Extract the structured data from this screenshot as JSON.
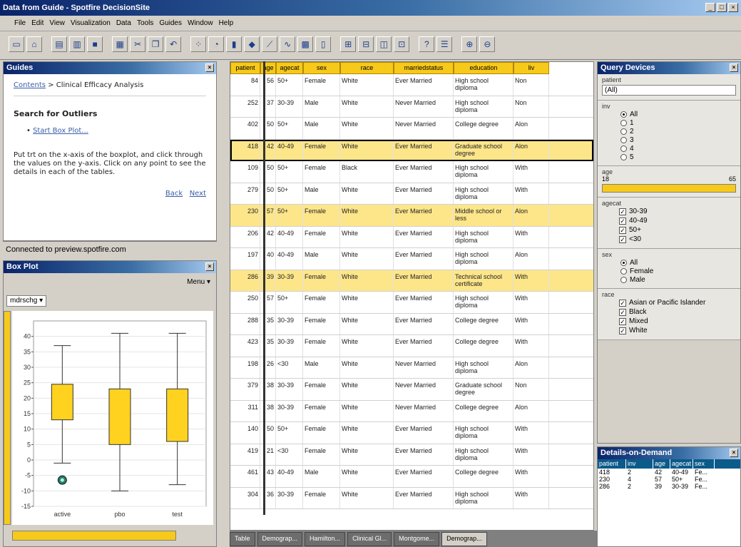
{
  "window": {
    "title": "Data from Guide - Spotfire DecisionSite"
  },
  "menu": [
    "File",
    "Edit",
    "View",
    "Visualization",
    "Data",
    "Tools",
    "Guides",
    "Window",
    "Help"
  ],
  "guides": {
    "title": "Guides",
    "breadcrumb_link": "Contents",
    "breadcrumb_rest": " > Clinical Efficacy Analysis",
    "heading": "Search for Outliers",
    "bullet_link": "Start Box Plot...",
    "body": "Put trt on the x-axis of the boxplot, and click through the values on the y-axis. Click on any point to see the details in each of the tables.",
    "back": "Back",
    "next": "Next"
  },
  "status": {
    "text": "Connected to preview.spotfire.com"
  },
  "boxplot": {
    "title": "Box Plot",
    "menu_label": "Menu",
    "y_selector": "mdrschg"
  },
  "chart_data": {
    "type": "box",
    "categories": [
      "active",
      "pbo",
      "test"
    ],
    "boxes": [
      {
        "category": "active",
        "min": -1,
        "q1": 13,
        "q3": 24.5,
        "max": 37
      },
      {
        "category": "pbo",
        "min": -10,
        "q1": 5,
        "q3": 23,
        "max": 41
      },
      {
        "category": "test",
        "min": -8,
        "q1": 6,
        "q3": 23,
        "max": 41
      }
    ],
    "outliers": [
      {
        "category": "active",
        "value": -6.5
      }
    ],
    "ylim": [
      -15,
      45
    ],
    "yticks": [
      -15,
      -10,
      -5,
      0,
      5,
      10,
      15,
      20,
      25,
      30,
      35,
      40
    ],
    "grid": true
  },
  "table": {
    "columns": [
      "patient",
      "age",
      "agecat",
      "sex",
      "race",
      "marriedstatus",
      "education",
      "liv"
    ],
    "rows": [
      {
        "patient": "84",
        "age": "56",
        "agecat": "50+",
        "sex": "Female",
        "race": "White",
        "married": "Ever Married",
        "education": "High school diploma",
        "liv": "Non"
      },
      {
        "patient": "252",
        "age": "37",
        "agecat": "30-39",
        "sex": "Male",
        "race": "White",
        "married": "Never Married",
        "education": "High school diploma",
        "liv": "Non"
      },
      {
        "patient": "402",
        "age": "50",
        "agecat": "50+",
        "sex": "Male",
        "race": "White",
        "married": "Never Married",
        "education": "College degree",
        "liv": "Alon"
      },
      {
        "patient": "418",
        "age": "42",
        "agecat": "40-49",
        "sex": "Female",
        "race": "White",
        "married": "Ever Married",
        "education": "Graduate school degree",
        "liv": "Alon"
      },
      {
        "patient": "109",
        "age": "50",
        "agecat": "50+",
        "sex": "Female",
        "race": "Black",
        "married": "Ever Married",
        "education": "High school diploma",
        "liv": "With"
      },
      {
        "patient": "279",
        "age": "50",
        "agecat": "50+",
        "sex": "Male",
        "race": "White",
        "married": "Ever Married",
        "education": "High school diploma",
        "liv": "With"
      },
      {
        "patient": "230",
        "age": "57",
        "agecat": "50+",
        "sex": "Female",
        "race": "White",
        "married": "Ever Married",
        "education": "Middle school or less",
        "liv": "Alon"
      },
      {
        "patient": "206",
        "age": "42",
        "agecat": "40-49",
        "sex": "Female",
        "race": "White",
        "married": "Ever Married",
        "education": "High school diploma",
        "liv": "With"
      },
      {
        "patient": "197",
        "age": "40",
        "agecat": "40-49",
        "sex": "Male",
        "race": "White",
        "married": "Ever Married",
        "education": "High school diploma",
        "liv": "Alon"
      },
      {
        "patient": "286",
        "age": "39",
        "agecat": "30-39",
        "sex": "Female",
        "race": "White",
        "married": "Ever Married",
        "education": "Technical school certificate",
        "liv": "With"
      },
      {
        "patient": "250",
        "age": "57",
        "agecat": "50+",
        "sex": "Female",
        "race": "White",
        "married": "Ever Married",
        "education": "High school diploma",
        "liv": "With"
      },
      {
        "patient": "288",
        "age": "35",
        "agecat": "30-39",
        "sex": "Female",
        "race": "White",
        "married": "Ever Married",
        "education": "College degree",
        "liv": "With"
      },
      {
        "patient": "423",
        "age": "35",
        "agecat": "30-39",
        "sex": "Female",
        "race": "White",
        "married": "Ever Married",
        "education": "College degree",
        "liv": "With"
      },
      {
        "patient": "198",
        "age": "26",
        "agecat": "<30",
        "sex": "Male",
        "race": "White",
        "married": "Never Married",
        "education": "High school diploma",
        "liv": "Alon"
      },
      {
        "patient": "379",
        "age": "38",
        "agecat": "30-39",
        "sex": "Female",
        "race": "White",
        "married": "Never Married",
        "education": "Graduate school degree",
        "liv": "Non"
      },
      {
        "patient": "311",
        "age": "38",
        "agecat": "30-39",
        "sex": "Female",
        "race": "White",
        "married": "Never Married",
        "education": "College degree",
        "liv": "Alon"
      },
      {
        "patient": "140",
        "age": "50",
        "agecat": "50+",
        "sex": "Female",
        "race": "White",
        "married": "Ever Married",
        "education": "High school diploma",
        "liv": "With"
      },
      {
        "patient": "419",
        "age": "21",
        "agecat": "<30",
        "sex": "Female",
        "race": "White",
        "married": "Ever Married",
        "education": "High school diploma",
        "liv": "With"
      },
      {
        "patient": "461",
        "age": "43",
        "agecat": "40-49",
        "sex": "Male",
        "race": "White",
        "married": "Ever Married",
        "education": "College degree",
        "liv": "With"
      },
      {
        "patient": "304",
        "age": "36",
        "agecat": "30-39",
        "sex": "Female",
        "race": "White",
        "married": "Ever Married",
        "education": "High school diploma",
        "liv": "With"
      }
    ],
    "highlighted_rows": [
      3,
      6,
      9
    ],
    "outlined_rows": [
      3
    ]
  },
  "tabs": [
    "Table",
    "Demograp...",
    "Hamilton...",
    "Clinical Gl...",
    "Montgome...",
    "Demograp..."
  ],
  "query": {
    "title": "Query Devices",
    "patient_label": "patient",
    "patient_value": "(All)",
    "inv_label": "inv",
    "inv_options": [
      "All",
      "1",
      "2",
      "3",
      "4",
      "5"
    ],
    "age_label": "age",
    "age_min": "18",
    "age_max": "65",
    "agecat_label": "agecat",
    "agecat_options": [
      "30-39",
      "40-49",
      "50+",
      "<30"
    ],
    "sex_label": "sex",
    "sex_options": [
      "All",
      "Female",
      "Male"
    ],
    "race_label": "race",
    "race_options": [
      "Asian or Pacific Islander",
      "Black",
      "Mixed",
      "White"
    ]
  },
  "details": {
    "title": "Details-on-Demand",
    "columns": [
      "patient",
      "inv",
      "age",
      "agecat",
      "sex"
    ],
    "rows": [
      [
        "418",
        "2",
        "42",
        "40-49",
        "Fe..."
      ],
      [
        "230",
        "4",
        "57",
        "50+",
        "Fe..."
      ],
      [
        "286",
        "2",
        "39",
        "30-39",
        "Fe..."
      ]
    ]
  },
  "colors": {
    "highlight": "#f7c91a",
    "box_fill": "#ffd21f",
    "titlebar": "#0a246a"
  }
}
